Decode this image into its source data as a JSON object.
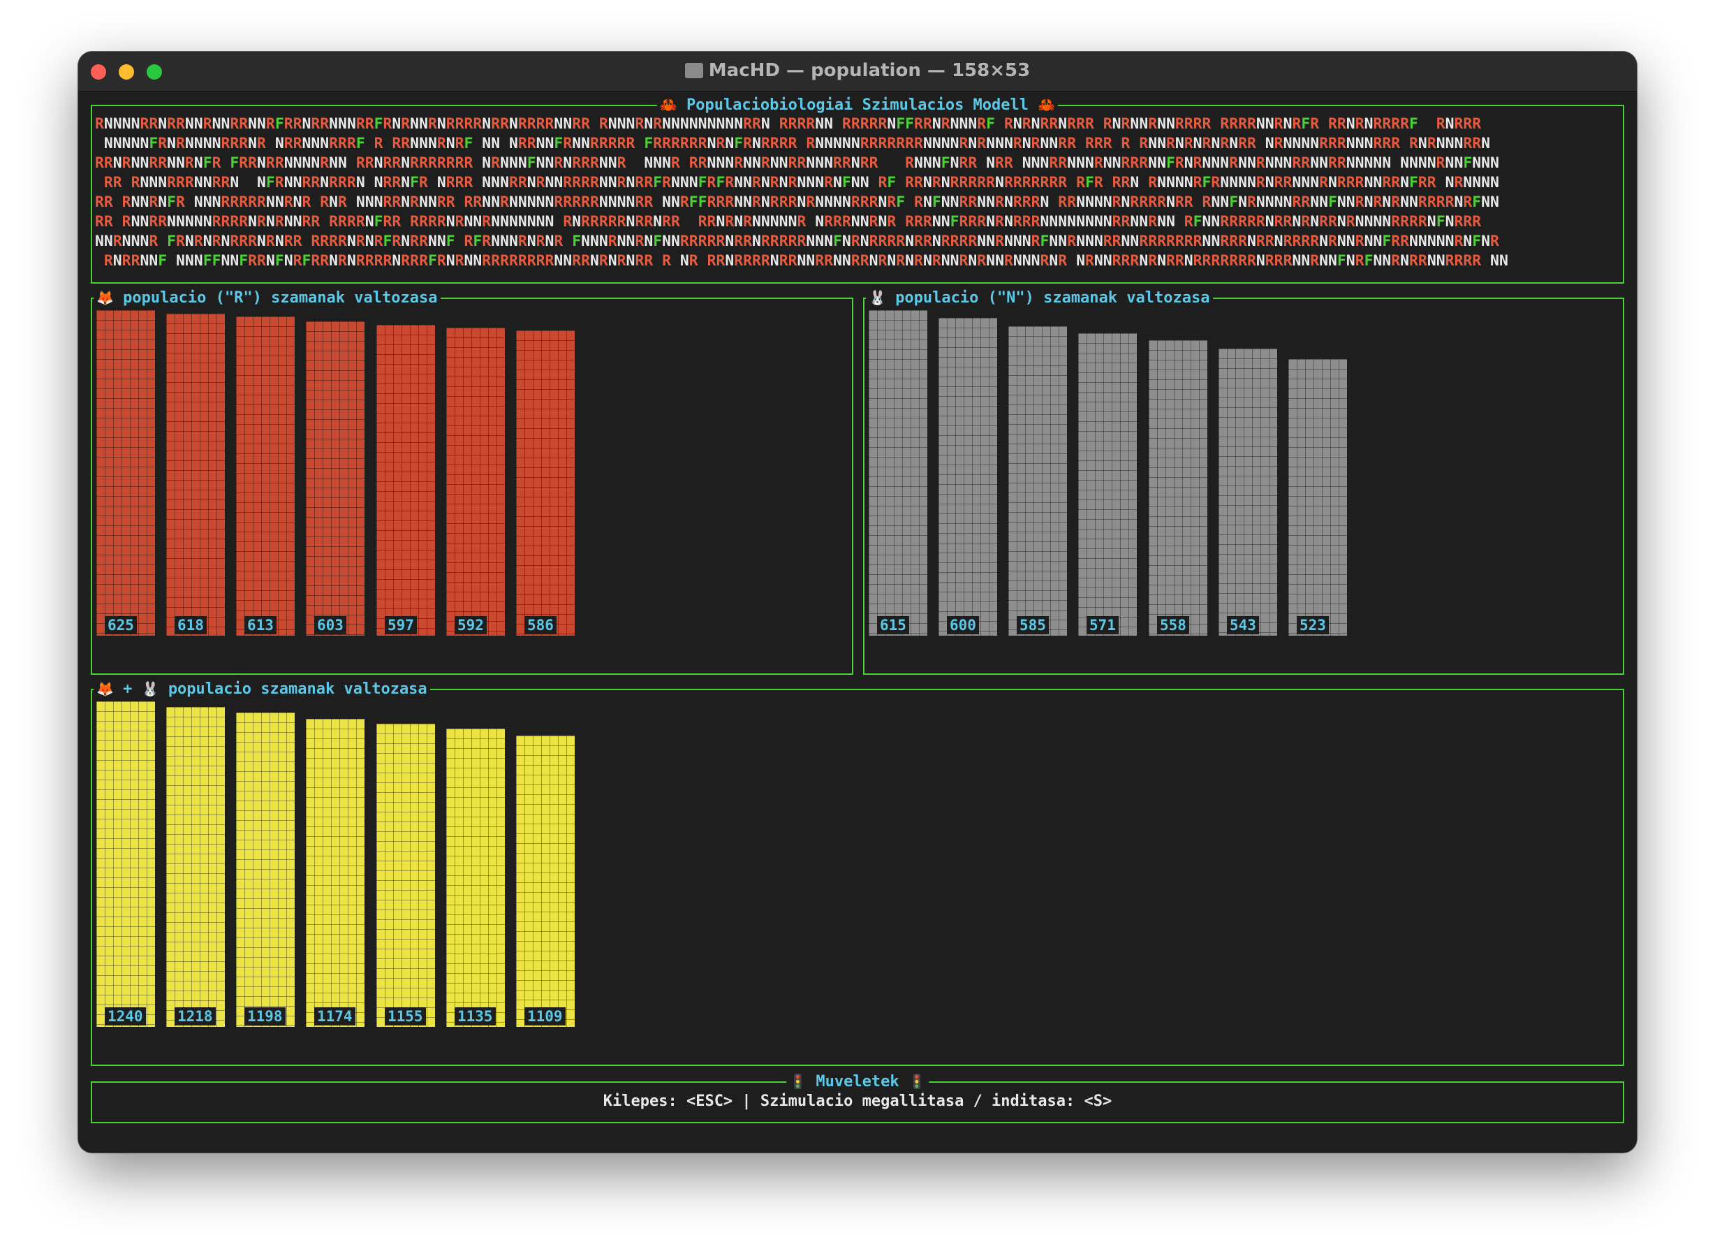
{
  "window": {
    "title": "MacHD — population — 158×53"
  },
  "simulation": {
    "title": "Populaciobiologiai Szimulacios Modell",
    "title_icon": "crab-emoji",
    "lines": [
      "RNNNNRRNRRNNRNNRRNNRFRRNRRNNNRRFRNRNNRNRRRRNRRNRRRRNNRR RNNNRNRNNNNNNNNNRRN RRRRNN RRRRRNFFRRNRNNNRF RNRNRRNRRR RNRNNRNNRRRR RRRRNNRNRFR RRNRNRRRRF  RNRRR",
      " NNNNNFRNRNNNNRRRNR NRRNNNRRRF R RRNNNRNRF NN NRRNNFRNNRRRRR FRRRRRRNRNFRNRRRR RNNNNNRRRRRRRNNNNRNRNNNRNRNNRR RRR R RNNRNRNRNRNRR NRNNNNRRRNNNRRR RNRNNNRRN",
      "RRNRNNRRNNRNFR FRRNRRNNNNRNN RRNRRNRRRRRRR NRNNNFNNRNRRRNNR  NNNR RRNNNRNNRNNRRNNNRRNRR   RNNNFNRR NRR NNNRRNNNRNNRRRNNFRNRNNNRNNRNNNRRNNRRNNNNN NNNNRNNFNNN",
      " RR RNNNRRRNNRRN  NFRNNRRNRRRN NRRNFR NRRR NNNRRNRNNRRRRNNRNRRFRNNNFRFRNNRNRNRNNNRNFNN RF RRNRNRRRRRNRRRRRRR RFR RRN RNNNNRFRNNNNRNRRNNNRNRRRNNRRNFRR NRNNNN",
      "RR RNNRNFR NNNRRRRRNNRNR RNR NNNRRNRNNRR RRNNRNNNNNRRRRRNNNNRR NNRFFRRRNNRNRRRNRNNNNRRRNRF RNFNNRRNNRNRRRN RRNNNNRNRRRRNRR RNNFNRNNNNRRNNFNNRNRNRNNRRRRNRFNN",
      "RR RNNRRNNNNNRRRRNRNRNNRR RRRRNFRR RRRRNRNNRNNNNNNN RNRRRRRNRRNRR  RRNRNRNNNNNR NRRRNNRNR RRRNNFRRRNRNRRRNNNNNNNNRRNNRNN RFNNRRRRRNRRNRNRRNRNNNNRRRRNFNRRR",
      "NNRNNNR FRNRNRNRRRNRNRR RRRRNRNRFRNRRNNF RFRNNNRNRNR FNNNRNNRNFNNRRRRRNRRNRRRRRNNNFNRNRRRRNRRNRRRRNNRNNNRFNNRNNNRRNNRRRRRRRNNRRRNRRNRRRRNRNNRNNFRRNNNNNRNFNR",
      " RNRRNNF NNNFFNNFRRNFNRFRRNRNRRRRNRRRFRNRNNRRRRRRRRNNRRNRNRNRR R NR RRNRRRRNRRNNRRNNRRNRNRNRNRNNRNRNNRNNNRNR NRNNRRRNRNRRNRRRRRRRNRRRNNRNNFNRFNNRNRRNNRRRR NN"
    ]
  },
  "chart_r": {
    "title": "populacio (\"R\") szamanak valtozasa",
    "icon": "fox-emoji",
    "color": "#c94a30"
  },
  "chart_n": {
    "title": "populacio (\"N\") szamanak valtozasa",
    "icon": "rabbit-emoji",
    "color": "#8e8e8e"
  },
  "chart_total": {
    "title": "populacio szamanak valtozasa",
    "plus": "+",
    "icons": [
      "fox-emoji",
      "rabbit-emoji"
    ],
    "color": "#ebe444"
  },
  "chart_data": [
    {
      "type": "bar",
      "values": [
        625,
        618,
        613,
        603,
        597,
        592,
        586
      ]
    },
    {
      "type": "bar",
      "values": [
        615,
        600,
        585,
        571,
        558,
        543,
        523
      ]
    },
    {
      "type": "bar",
      "values": [
        1240,
        1218,
        1198,
        1174,
        1155,
        1135,
        1109
      ]
    }
  ],
  "controls": {
    "title": "Muveletek",
    "title_icon": "traffic-light-emoji",
    "help_text": "Kilepes: <ESC> | Szimulacio megallitasa / inditasa: <S>"
  }
}
